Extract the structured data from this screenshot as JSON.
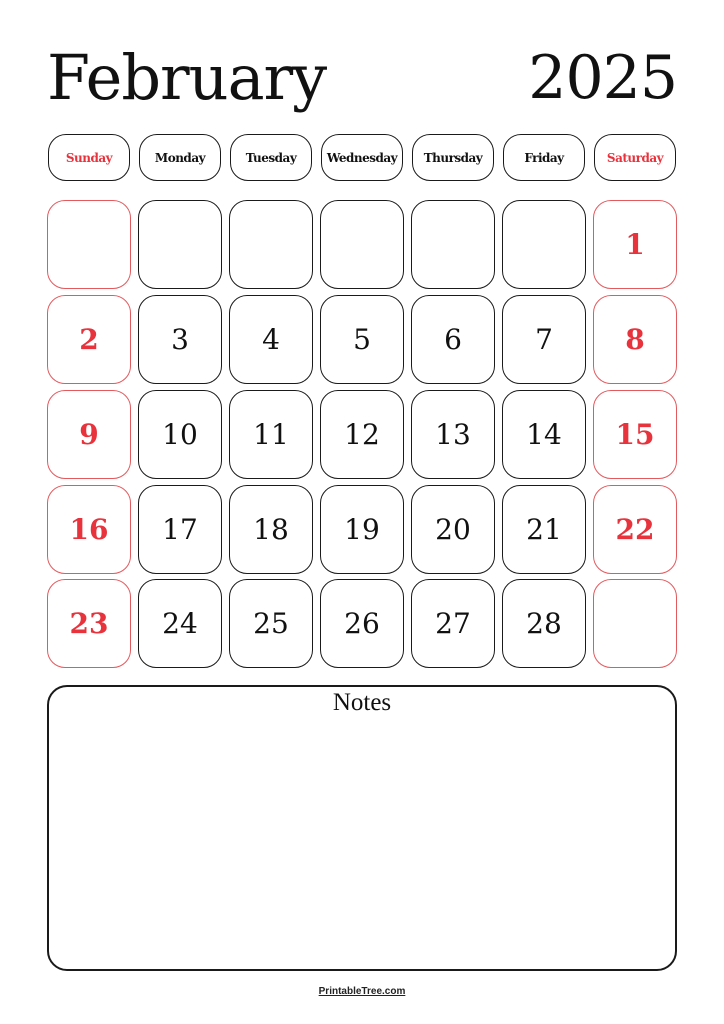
{
  "header": {
    "month": "February",
    "year": "2025"
  },
  "weekdays": [
    {
      "label": "Sunday",
      "weekend": true
    },
    {
      "label": "Monday",
      "weekend": false
    },
    {
      "label": "Tuesday",
      "weekend": false
    },
    {
      "label": "Wednesday",
      "weekend": false
    },
    {
      "label": "Thursday",
      "weekend": false
    },
    {
      "label": "Friday",
      "weekend": false
    },
    {
      "label": "Saturday",
      "weekend": true
    }
  ],
  "weeks": [
    [
      "",
      "",
      "",
      "",
      "",
      "",
      "1"
    ],
    [
      "2",
      "3",
      "4",
      "5",
      "6",
      "7",
      "8"
    ],
    [
      "9",
      "10",
      "11",
      "12",
      "13",
      "14",
      "15"
    ],
    [
      "16",
      "17",
      "18",
      "19",
      "20",
      "21",
      "22"
    ],
    [
      "23",
      "24",
      "25",
      "26",
      "27",
      "28",
      ""
    ]
  ],
  "notes": {
    "title": "Notes"
  },
  "footer": {
    "text": "PrintableTree.com"
  },
  "colors": {
    "weekend": "#e8323c",
    "weekend_border": "#e35a5e",
    "border": "#1a1a1a"
  }
}
